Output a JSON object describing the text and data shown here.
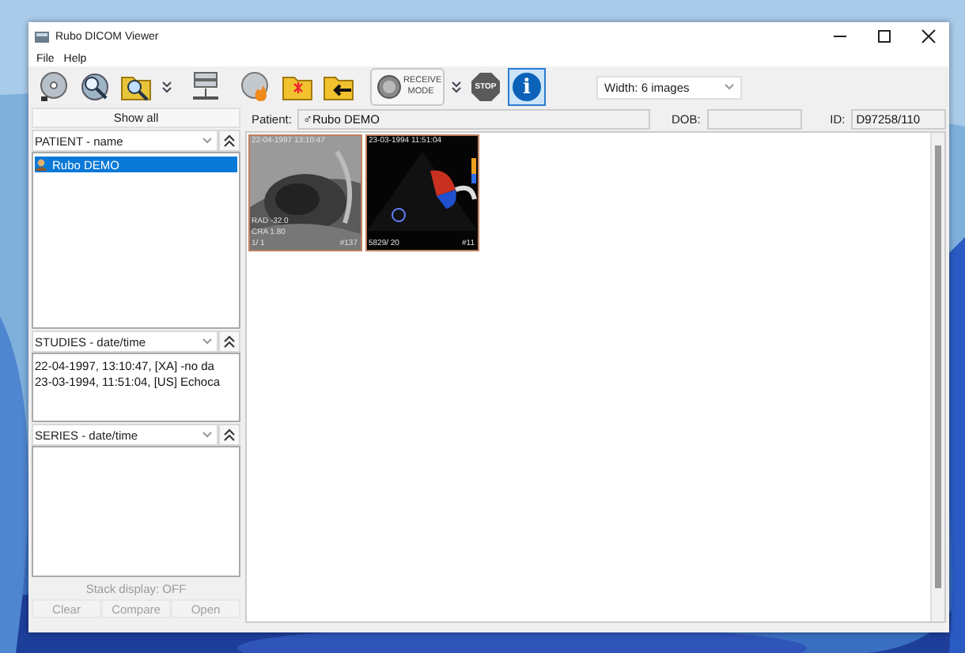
{
  "window": {
    "title": "Rubo DICOM Viewer"
  },
  "menu": [
    "File",
    "Help"
  ],
  "toolbar": [
    {
      "kind": "disc",
      "selected": false
    },
    {
      "kind": "search",
      "selected": false
    },
    {
      "kind": "browse",
      "selected": false
    },
    {
      "kind": "more",
      "selected": false
    },
    {
      "kind": "network",
      "selected": false
    },
    {
      "kind": "burn",
      "selected": false
    },
    {
      "kind": "export",
      "selected": false
    },
    {
      "kind": "import",
      "selected": false
    },
    {
      "kind": "mode",
      "label": "RECEIVE MODE",
      "selected": false
    },
    {
      "kind": "more",
      "selected": false
    },
    {
      "kind": "stop",
      "label": "STOP",
      "selected": false
    },
    {
      "kind": "info",
      "label": "i",
      "selected": true
    }
  ],
  "width_select": {
    "value": "Width: 6 images"
  },
  "show_all": "Show all",
  "panels": [
    {
      "header": "PATIENT - name",
      "items": [
        {
          "label": "Rubo DEMO",
          "selected": true
        }
      ]
    },
    {
      "header": "STUDIES - date/time",
      "items": [
        {
          "label": "22-04-1997, 13:10:47, [XA] -no da",
          "selected": false
        },
        {
          "label": "23-03-1994, 11:51:04, [US] Echoca",
          "selected": false
        }
      ]
    },
    {
      "header": "SERIES - date/time"
    }
  ],
  "stack_display": "Stack display: OFF",
  "actions": [
    {
      "label": "Clear",
      "disabled": true
    },
    {
      "label": "Compare",
      "disabled": true
    },
    {
      "label": "Open",
      "disabled": true
    }
  ],
  "patient_bar": {
    "patient_label": "Patient:",
    "sex": "♂",
    "patient": "Rubo DEMO",
    "dob_label": "DOB:",
    "id_label": "ID:",
    "id": "D97258/110"
  },
  "thumbnails": [
    {
      "kind": "xray",
      "date": "22-04-1997   13:10:47",
      "lines": [
        "RAD -32.0",
        "CRA 1.80",
        "1/ 1"
      ],
      "number": "#137"
    },
    {
      "kind": "echo",
      "date": "23-03-1994   11:51:04",
      "lines": [
        "5829/ 20"
      ],
      "number": "#11"
    }
  ]
}
